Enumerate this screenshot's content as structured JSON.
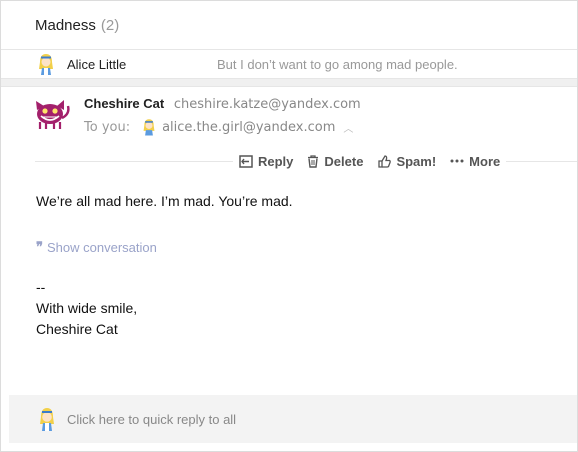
{
  "thread": {
    "title": "Madness",
    "count": "(2)"
  },
  "collapsed_message": {
    "sender": "Alice Little",
    "snippet": "But I don’t want to go among mad people."
  },
  "message": {
    "from_name": "Cheshire Cat",
    "from_email": "cheshire.katze@yandex.com",
    "to_label": "To you:",
    "to_email": "alice.the.girl@yandex.com",
    "body": "We’re all mad here. I’m mad. You’re mad.",
    "show_conversation": "Show conversation",
    "signature_dash": "--",
    "signature_line1": "With wide smile,",
    "signature_line2": "Cheshire Cat"
  },
  "actions": {
    "reply": "Reply",
    "delete": "Delete",
    "spam": "Spam!",
    "more": "More"
  },
  "quick_reply": {
    "placeholder": "Click here to quick reply to all"
  },
  "colors": {
    "link": "#9aa3c9",
    "cat_avatar": "#a3206b",
    "muted": "#999999"
  }
}
